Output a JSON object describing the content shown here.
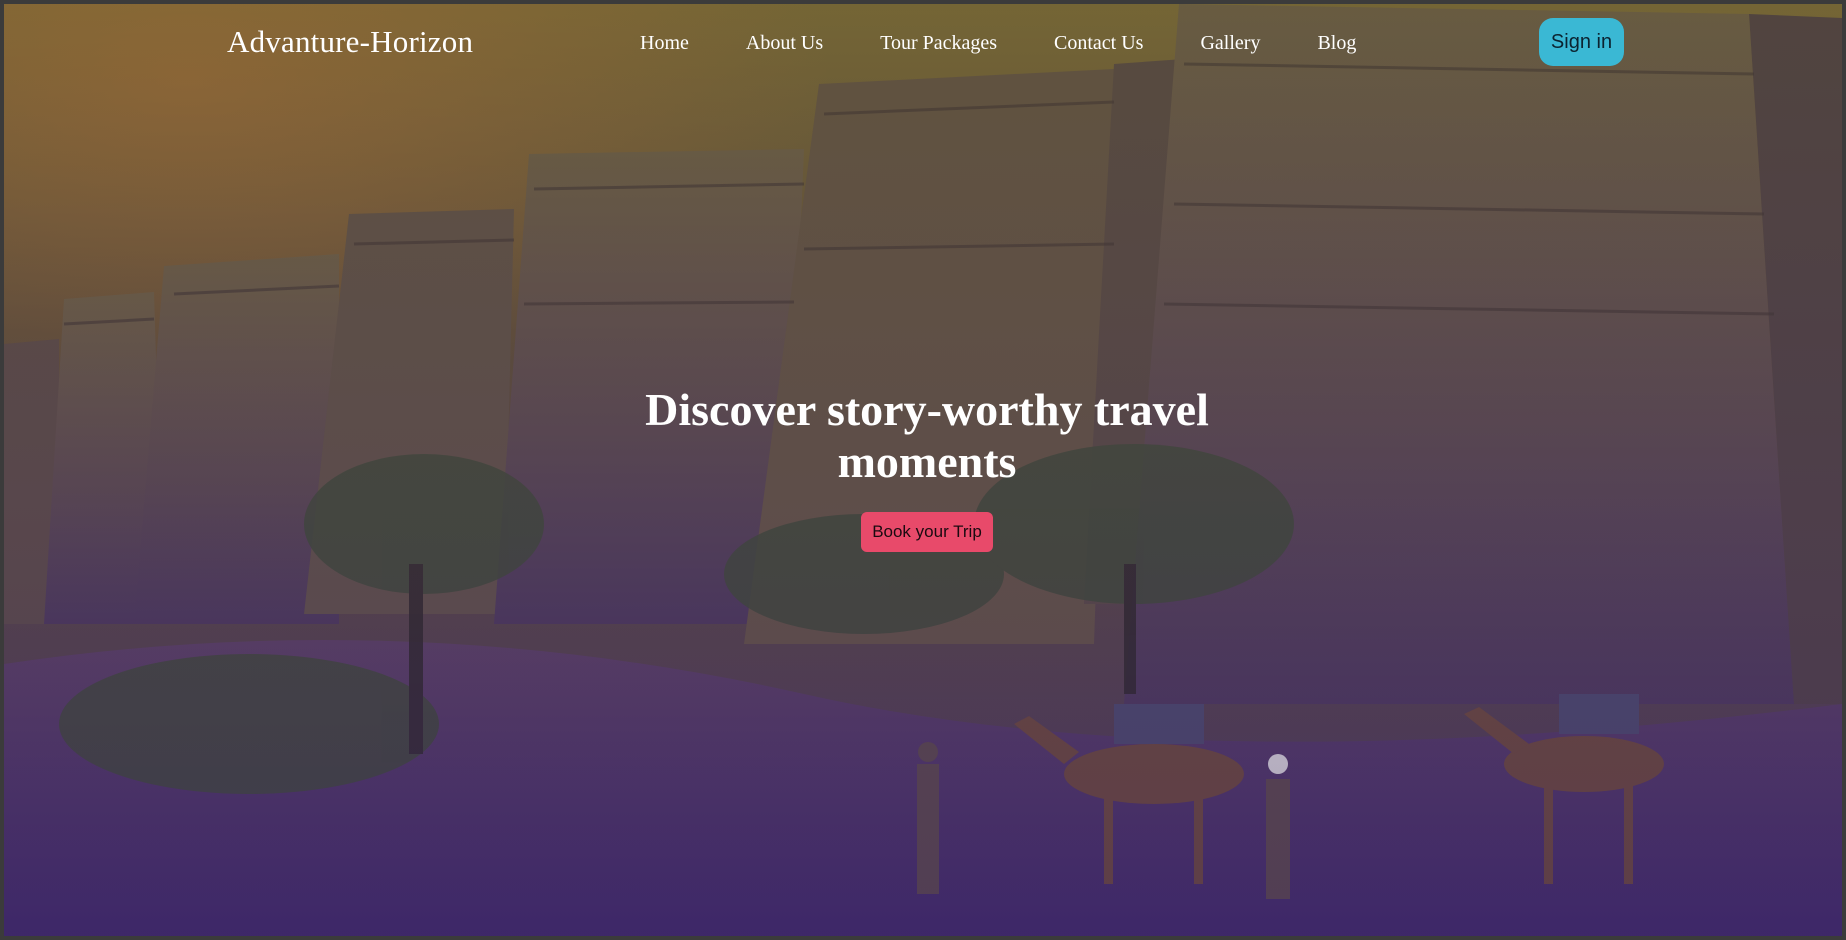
{
  "nav": {
    "brand": "Advanture-Horizon",
    "links": [
      "Home",
      "About Us",
      "Tour Packages",
      "Contact Us",
      "Gallery",
      "Blog"
    ],
    "sign_in_label": "Sign in"
  },
  "hero": {
    "headline": "Discover story-worthy travel moments",
    "cta_label": "Book your Trip",
    "background": "desert-fort-with-camels-image"
  },
  "colors": {
    "sign_in_bg": "#3ab8d4",
    "cta_bg": "#e84a6a",
    "overlay_top": "#5a5a2e",
    "overlay_bottom": "#3c2a6e"
  }
}
